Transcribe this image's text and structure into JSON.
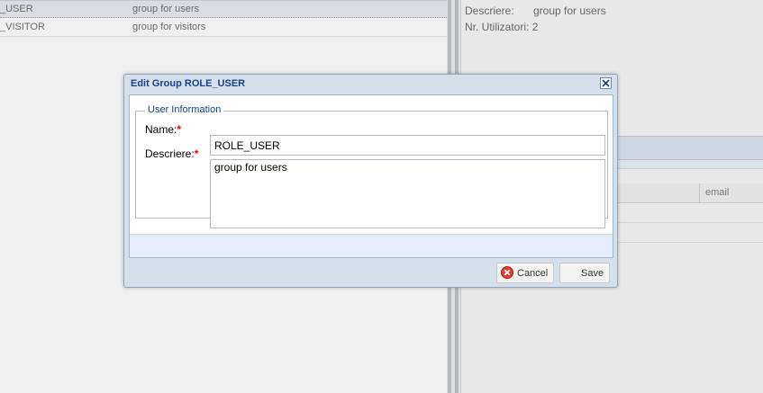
{
  "left_grid": {
    "rows": [
      {
        "name": "_USER",
        "description": "group for users",
        "selected": true
      },
      {
        "name": "_VISITOR",
        "description": "group for visitors",
        "selected": false
      }
    ]
  },
  "details": {
    "description_label": "Descriere:",
    "description_value": "group for users",
    "users_label": "Nr. Utilizatori:",
    "users_value": "2"
  },
  "right_grid": {
    "email_column": "email"
  },
  "dialog": {
    "title": "Edit Group ROLE_USER",
    "fieldset_legend": "User Information",
    "name_label": "Name:",
    "name_value": "ROLE_USER",
    "description_label": "Descriere:",
    "description_value": "group for users",
    "required_marker": "*",
    "cancel_label": "Cancel",
    "save_label": "Save"
  },
  "icons": {
    "close": "close-icon",
    "cancel": "cancel-icon"
  },
  "colors": {
    "title_text": "#15428b",
    "required": "#dd0000",
    "cancel_icon": "#e23b30",
    "dialog_frame": "#d6e0ea"
  }
}
